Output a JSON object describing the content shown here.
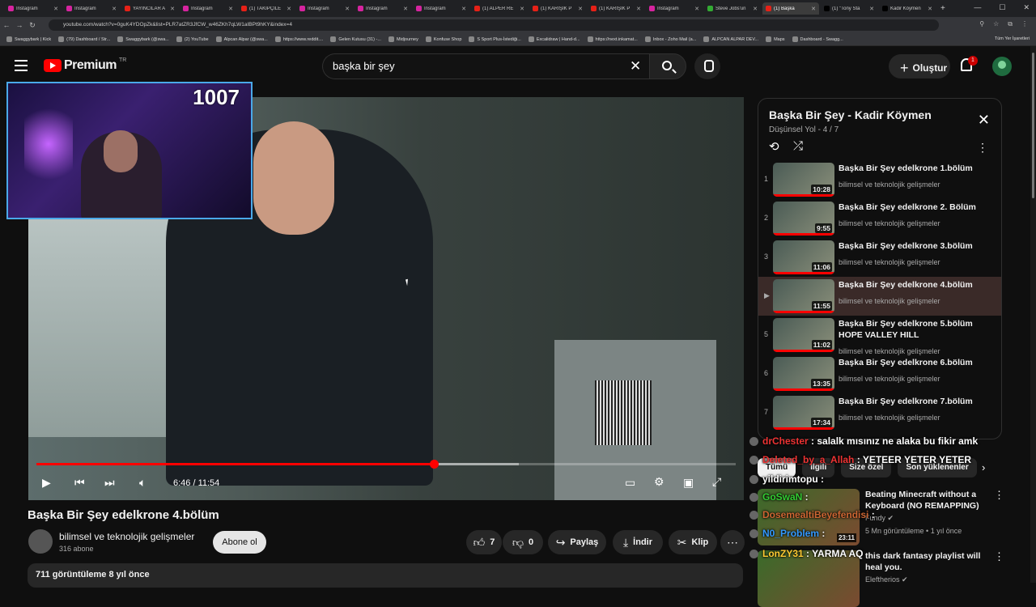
{
  "browser": {
    "tabs": [
      {
        "title": "Instagram",
        "icon": "instagram-icon",
        "color": "#d6249f"
      },
      {
        "title": "Instagram",
        "icon": "instagram-icon",
        "color": "#d6249f"
      },
      {
        "title": "YAYINCILAR A",
        "icon": "youtube-icon",
        "color": "#e62117"
      },
      {
        "title": "Instagram",
        "icon": "instagram-icon",
        "color": "#d6249f"
      },
      {
        "title": "(1) TAKİPÇİLE",
        "icon": "youtube-icon",
        "color": "#e62117"
      },
      {
        "title": "Instagram",
        "icon": "instagram-icon",
        "color": "#d6249f"
      },
      {
        "title": "Instagram",
        "icon": "instagram-icon",
        "color": "#d6249f"
      },
      {
        "title": "Instagram",
        "icon": "instagram-icon",
        "color": "#d6249f"
      },
      {
        "title": "(1) ALPER RE",
        "icon": "youtube-icon",
        "color": "#e62117"
      },
      {
        "title": "(1) KARIŞIK P",
        "icon": "youtube-icon",
        "color": "#e62117"
      },
      {
        "title": "(1) KARIŞIK P",
        "icon": "youtube-icon",
        "color": "#e62117"
      },
      {
        "title": "Instagram",
        "icon": "instagram-icon",
        "color": "#d6249f"
      },
      {
        "title": "Steve Jobs'un",
        "icon": "globe-icon",
        "color": "#3a3"
      },
      {
        "title": "(1) Başka",
        "icon": "youtube-icon",
        "color": "#e62117",
        "active": true
      },
      {
        "title": "(1) \"Tony Sta",
        "icon": "x-icon",
        "color": "#000"
      },
      {
        "title": "Kadir Köymen",
        "icon": "x-icon",
        "color": "#000"
      }
    ],
    "url": "youtube.com/watch?v=0guK4YDOpZk&list=PLR7atZR3JfCW_w46ZKh7qLW1aIBPt9hKY&index=4",
    "bookmarks": [
      "Swaggybark | Kick",
      "(79) Dashboard / Str...",
      "Swaggybark (@swa...",
      "(2) YouTube",
      "Alpcan Alpar (@swa...",
      "https://www.reddit....",
      "Gelen Kutusu (31) -...",
      "Midjourney",
      "Konfuse Shop",
      "S Sport Plus-İstediği...",
      "Excalidraw | Hand-d...",
      "https://next.inkamat...",
      "Inbox - Zoho Mail (a...",
      "ALPCAN ALPAR DEV...",
      "Maps",
      "Dashboard - Swagg..."
    ],
    "bookmarks_all": "Tüm Yer İşaretleri"
  },
  "masthead": {
    "logo_text": "Premium",
    "logo_region": "TR",
    "search_value": "başka bir şey",
    "create_label": "Oluştur",
    "notification_count": "1"
  },
  "stream": {
    "viewer_count": "1007"
  },
  "player": {
    "current_time": "6:46",
    "duration": "11:54",
    "time_display": "6:46 / 11:54",
    "progress_fraction": 0.568,
    "buffer_fraction": 0.69
  },
  "video": {
    "title": "Başka Bir Şey edelkrone 4.bölüm",
    "channel": "bilimsel ve teknolojik gelişmeler",
    "subscribers": "316 abone",
    "subscribe_label": "Abone ol",
    "likes": "7",
    "dislikes": "0",
    "share_label": "Paylaş",
    "download_label": "İndir",
    "clip_label": "Klip",
    "views_date": "711 görüntüleme  8 yıl önce"
  },
  "playlist": {
    "title": "Başka Bir Şey - Kadir Köymen",
    "subtitle": "Düşünsel Yol - 4 / 7",
    "items": [
      {
        "index": "1",
        "title": "Başka Bir Şey edelkrone 1.bölüm",
        "channel": "bilimsel ve teknolojik gelişmeler",
        "duration": "10:28"
      },
      {
        "index": "2",
        "title": "Başka Bir Şey edelkrone 2. Bölüm",
        "channel": "bilimsel ve teknolojik gelişmeler",
        "duration": "9:55"
      },
      {
        "index": "3",
        "title": "Başka Bir Şey edelkrone 3.bölüm",
        "channel": "bilimsel ve teknolojik gelişmeler",
        "duration": "11:06"
      },
      {
        "index": "▶",
        "title": "Başka Bir Şey edelkrone 4.bölüm",
        "channel": "bilimsel ve teknolojik gelişmeler",
        "duration": "11:55",
        "current": true
      },
      {
        "index": "5",
        "title": "Başka Bir Şey edelkrone 5.bölüm HOPE VALLEY HILL",
        "channel": "bilimsel ve teknolojik gelişmeler",
        "duration": "11:02"
      },
      {
        "index": "6",
        "title": "Başka Bir Şey edelkrone 6.bölüm",
        "channel": "bilimsel ve teknolojik gelişmeler",
        "duration": "13:35"
      },
      {
        "index": "7",
        "title": "Başka Bir Şey edelkrone 7.bölüm",
        "channel": "bilimsel ve teknolojik gelişmeler",
        "duration": "17:34"
      }
    ]
  },
  "chips": [
    "Tümü",
    "İlgili",
    "Size özel",
    "Son yüklenenler"
  ],
  "recommendations": [
    {
      "title": "Beating Minecraft without a Keyboard (NO REMAPPING)",
      "channel": "Fundy",
      "meta": "5 Mn görüntüleme • 1 yıl önce",
      "duration": "23:11"
    },
    {
      "title": "this dark fantasy playlist will heal you.",
      "channel": "Eleftherios",
      "meta": "",
      "duration": ""
    }
  ],
  "chat": [
    {
      "user": "drChester",
      "message": ": salalk mısınız ne alaka bu fikir amk",
      "color": "#e33"
    },
    {
      "user": "Deleted_by_a_Allah",
      "message": ": YETEER YETER YETER",
      "color": "#e33"
    },
    {
      "user": "yildirimtopu",
      "message": ":",
      "color": "#fff"
    },
    {
      "user": "GoSwaN",
      "message": ":",
      "color": "#3c3"
    },
    {
      "user": "DosemealtiBeyefendisi",
      "message": ":",
      "color": "#c63"
    },
    {
      "user": "N0_Problem",
      "message": ":",
      "color": "#39f"
    },
    {
      "user": "LonZY31",
      "message": ": YARMA AQ",
      "color": "#fc3"
    }
  ]
}
